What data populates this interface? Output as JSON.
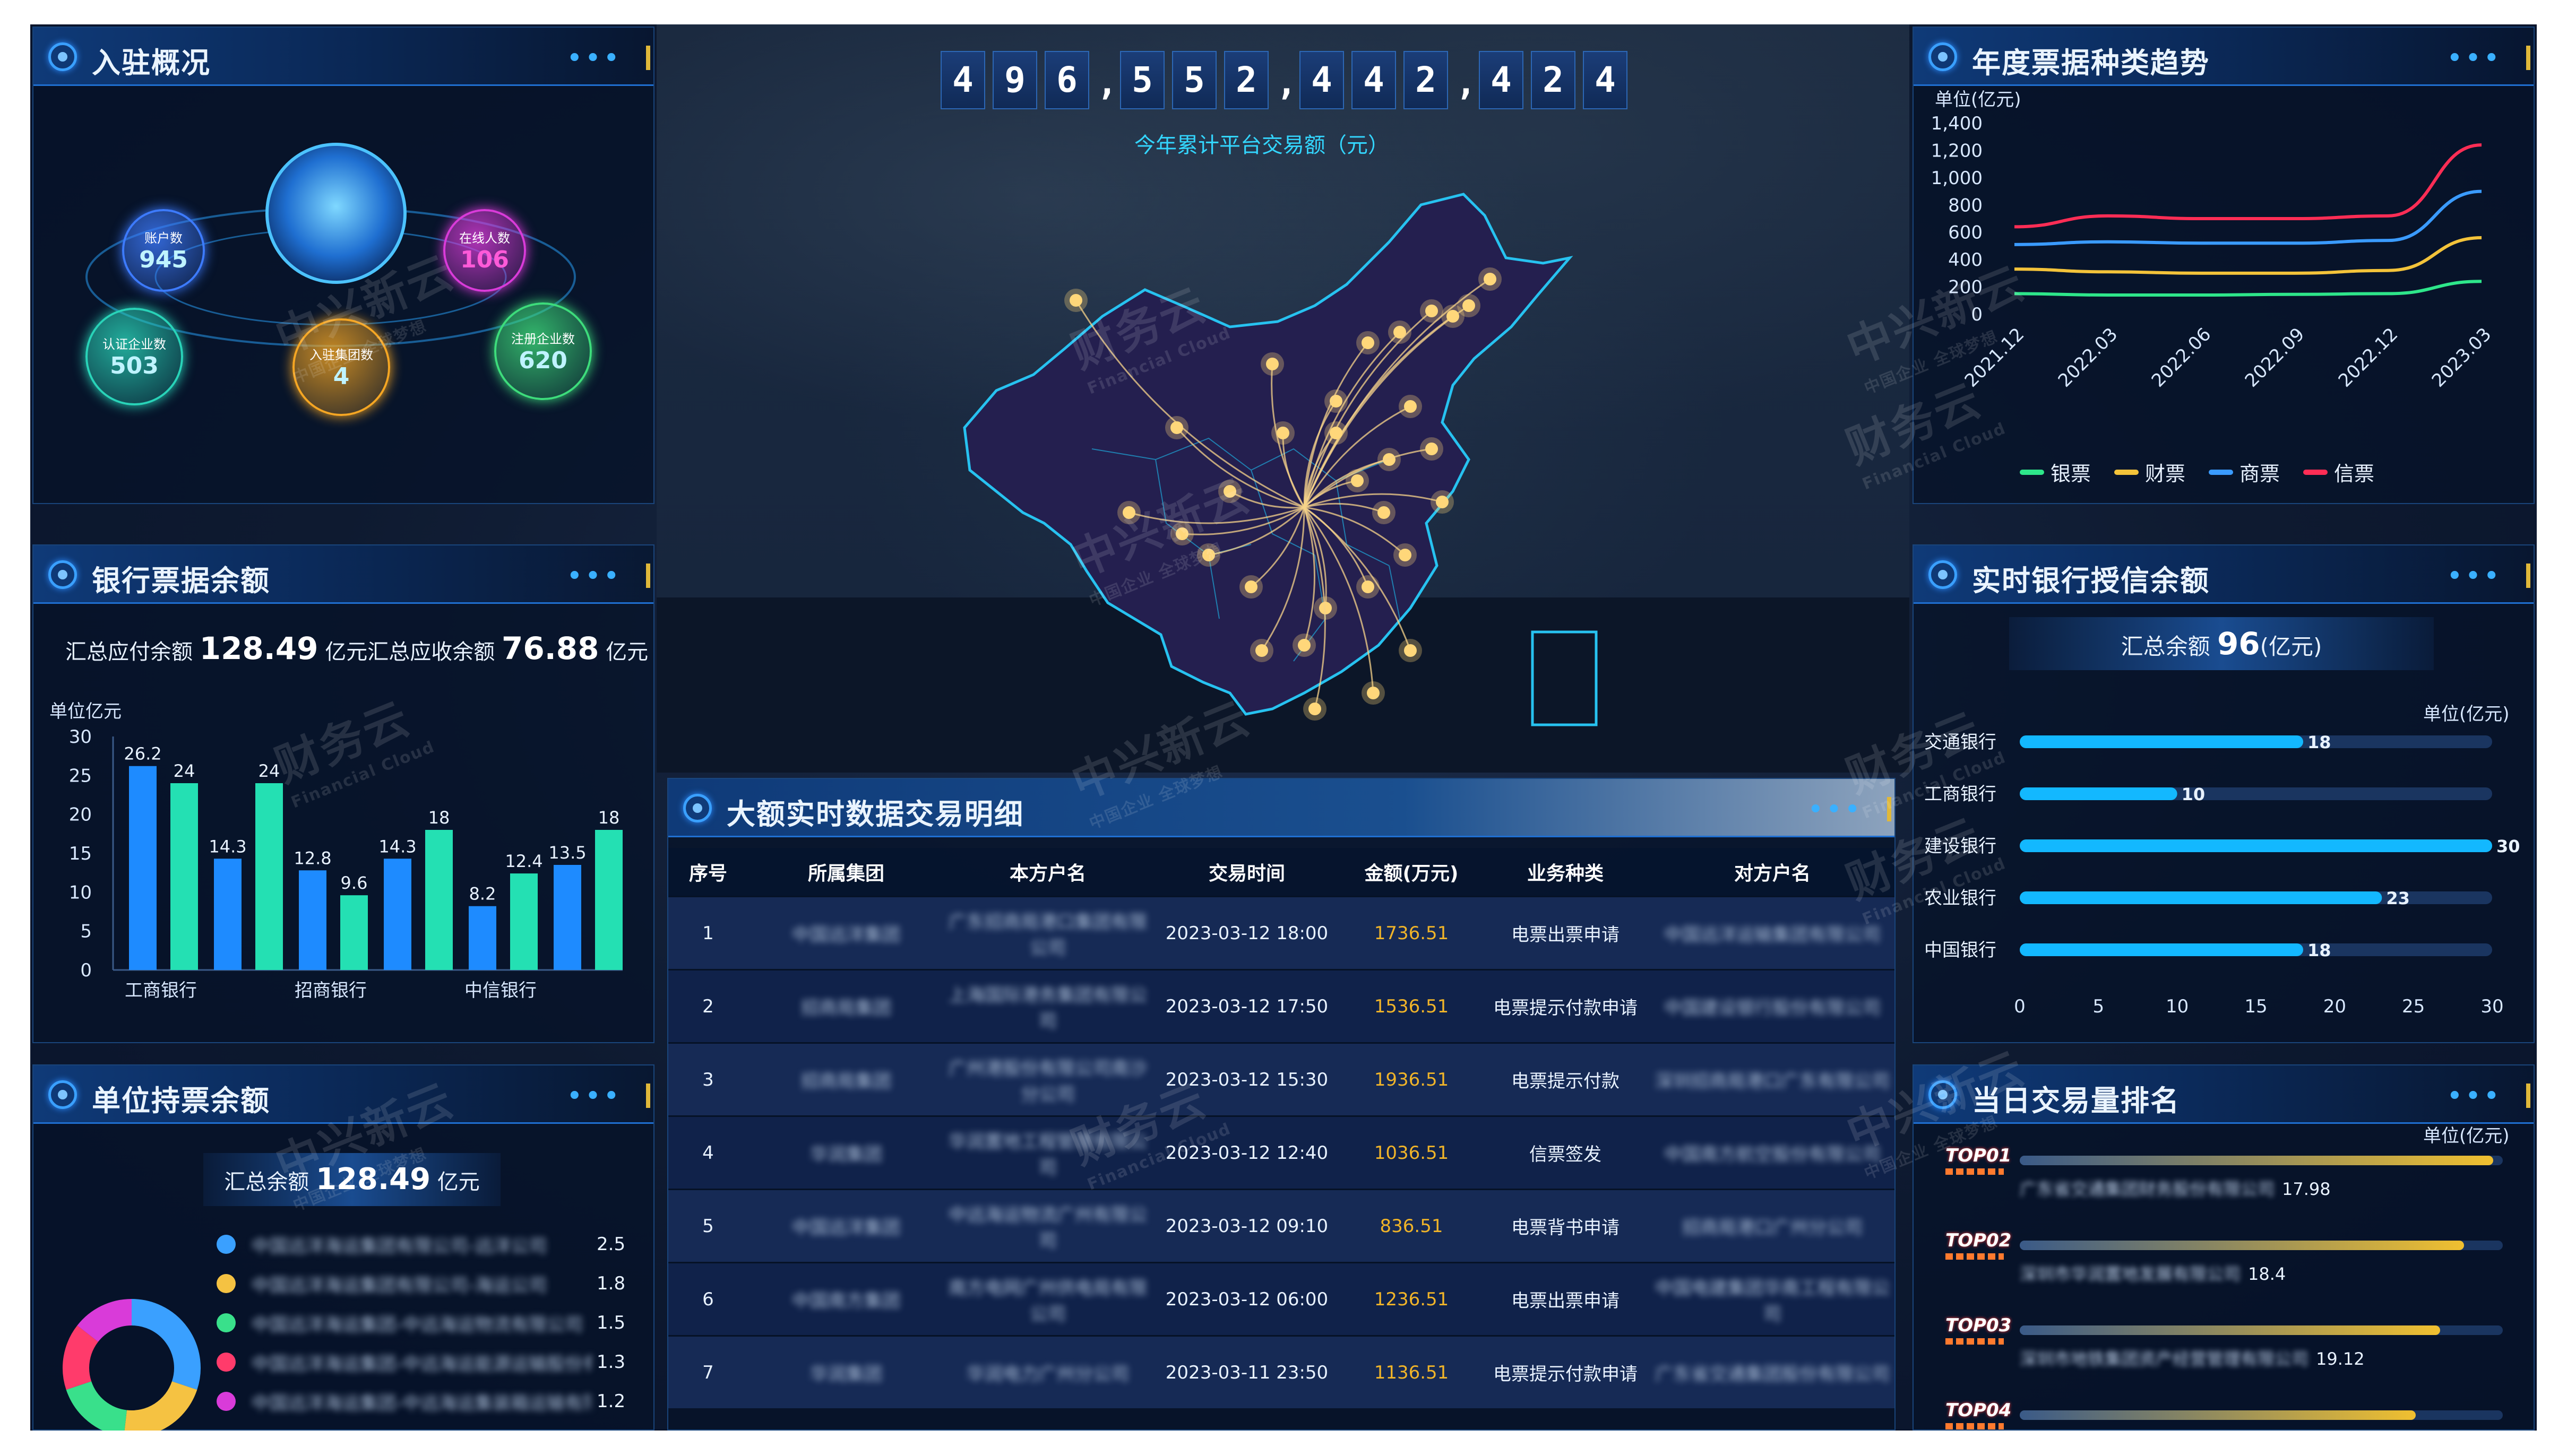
{
  "header": {
    "digits": [
      "4",
      "9",
      "6",
      ",",
      "5",
      "5",
      "2",
      ",",
      "4",
      "4",
      "2",
      ",",
      "4",
      "2",
      "4"
    ],
    "subtitle": "今年累计平台交易额（元）"
  },
  "watermark": {
    "main": "中兴新云",
    "sub": "财务云",
    "tag": "Financial Cloud",
    "slogan": "中国企业 全球梦想"
  },
  "panels": {
    "settled": {
      "title": "入驻概况",
      "more": "•••",
      "bubbles": [
        {
          "label": "账户数",
          "value": "945"
        },
        {
          "label": "在线人数",
          "value": "106"
        },
        {
          "label": "认证企业数",
          "value": "503"
        },
        {
          "label": "入驻集团数",
          "value": "4"
        },
        {
          "label": "注册企业数",
          "value": "620"
        }
      ]
    },
    "bank_bills": {
      "title": "银行票据余额",
      "more": "•••",
      "payable_label": "汇总应付余额",
      "payable_value": "128.49",
      "unit_yi": "亿元",
      "receivable_label": "汇总应收余额",
      "receivable_value": "76.88",
      "unit_label": "单位亿元"
    },
    "unit_holdings": {
      "title": "单位持票余额",
      "more": "•••",
      "summary_label": "汇总余额",
      "summary_value": "128.49",
      "summary_unit": "亿元",
      "items": [
        {
          "name": "中国远洋海运集团有限公司-远洋公司",
          "value": "2.5",
          "color": "#3aa0ff"
        },
        {
          "name": "中国远洋海运集团有限公司-海运公司",
          "value": "1.8",
          "color": "#f5c242"
        },
        {
          "name": "中国远洋海运集团-中远海运物流有限公司",
          "value": "1.5",
          "color": "#39e08b"
        },
        {
          "name": "中国远洋海运集团-中远海运能源运输股份有限公司",
          "value": "1.3",
          "color": "#ff3b6b"
        },
        {
          "name": "中国远洋海运集团-中远海运集装箱运输有限公司",
          "value": "1.2",
          "color": "#d93bd9"
        }
      ]
    },
    "annual_trend": {
      "title": "年度票据种类趋势",
      "more": "•••",
      "unit_label": "单位(亿元)"
    },
    "credit_balance": {
      "title": "实时银行授信余额",
      "more": "•••",
      "summary_prefix": "汇总余额",
      "summary_value": "96",
      "summary_unit": "(亿元)",
      "unit_label": "单位(亿元)",
      "banks": [
        {
          "name": "交通银行",
          "value": 18
        },
        {
          "name": "工商银行",
          "value": 10
        },
        {
          "name": "建设银行",
          "value": 30
        },
        {
          "name": "农业银行",
          "value": 23
        },
        {
          "name": "中国银行",
          "value": 18
        }
      ],
      "ticks": [
        "0",
        "5",
        "10",
        "15",
        "20",
        "25",
        "30"
      ]
    },
    "ranking": {
      "title": "当日交易量排名",
      "more": "•••",
      "unit_label": "单位(亿元)",
      "items": [
        {
          "rank": "TOP01",
          "name": "广东省交通集团财务股份有限公司",
          "value": "17.98",
          "fill": 0.98
        },
        {
          "rank": "TOP02",
          "name": "深圳市华润置地发展有限公司",
          "value": "18.4",
          "fill": 0.92
        },
        {
          "rank": "TOP03",
          "name": "深圳市地铁集团资产经营管理有限公司",
          "value": "19.12",
          "fill": 0.87
        },
        {
          "rank": "TOP04",
          "name": "",
          "value": "",
          "fill": 0.82
        }
      ]
    },
    "details": {
      "title": "大额实时数据交易明细",
      "more": "•••",
      "columns": [
        "序号",
        "所属集团",
        "本方户名",
        "交易时间",
        "金额(万元)",
        "业务种类",
        "对方户名"
      ],
      "rows": [
        {
          "no": "1",
          "group": "中国远洋集团",
          "own": "广东招商局港口集团有限公司",
          "time": "2023-03-12 18:00",
          "amount": "1736.51",
          "type": "电票出票申请",
          "counter": "中国远洋运输集团有限公司"
        },
        {
          "no": "2",
          "group": "招商局集团",
          "own": "上海国际港务集团有限公司",
          "time": "2023-03-12 17:50",
          "amount": "1536.51",
          "type": "电票提示付款申请",
          "counter": "中国建设银行股份有限公司"
        },
        {
          "no": "3",
          "group": "招商局集团",
          "own": "广州港股份有限公司南沙分公司",
          "time": "2023-03-12 15:30",
          "amount": "1936.51",
          "type": "电票提示付款",
          "counter": "深圳招商局港口广东有限公司"
        },
        {
          "no": "4",
          "group": "华润集团",
          "own": "华润置地工程管理有限公司",
          "time": "2023-03-12 12:40",
          "amount": "1036.51",
          "type": "信票签发",
          "counter": "中国南方航空股份有限公司"
        },
        {
          "no": "5",
          "group": "中国远洋集团",
          "own": "中远海运物流广州有限公司",
          "time": "2023-03-12 09:10",
          "amount": "836.51",
          "type": "电票背书申请",
          "counter": "招商局港口广州分公司"
        },
        {
          "no": "6",
          "group": "中国南方集团",
          "own": "南方电网广州供电局有限公司",
          "time": "2023-03-12 06:00",
          "amount": "1236.51",
          "type": "电票出票申请",
          "counter": "中国电建集团华南工程有限公司"
        },
        {
          "no": "7",
          "group": "华润集团",
          "own": "华润电力广州分公司",
          "time": "2023-03-11 23:50",
          "amount": "1136.51",
          "type": "电票提示付款申请",
          "counter": "广东省交通集团股份有限公司"
        }
      ]
    }
  },
  "chart_data": [
    {
      "type": "bar",
      "title": "银行票据余额",
      "categories": [
        "工商银行",
        "",
        "招商银行",
        "",
        "中信银行",
        ""
      ],
      "series": [
        {
          "values": [
            26.2,
            14.3,
            12.8,
            14.3,
            8.2,
            13.5
          ]
        },
        {
          "values": [
            24,
            24,
            9.6,
            18,
            12.4,
            18
          ]
        }
      ],
      "ylabel": "单位亿元",
      "ylim": [
        0,
        30
      ],
      "yticks": [
        "0",
        "5",
        "10",
        "15",
        "20",
        "25",
        "30"
      ],
      "colors": [
        "#1e8bff",
        "#24e0b3"
      ]
    },
    {
      "type": "line",
      "title": "年度票据种类趋势",
      "x": [
        "2021.12",
        "2022.03",
        "2022.06",
        "2022.09",
        "2022.12",
        "2023.03"
      ],
      "ylabel": "单位(亿元)",
      "ylim": [
        0,
        1400
      ],
      "yticks": [
        "0",
        "200",
        "400",
        "600",
        "800",
        "1,000",
        "1,200",
        "1,400"
      ],
      "series": [
        {
          "name": "银票",
          "color": "#2ee68a",
          "values": [
            150,
            140,
            140,
            145,
            150,
            240
          ]
        },
        {
          "name": "财票",
          "color": "#f3c33a",
          "values": [
            330,
            310,
            300,
            300,
            320,
            560
          ]
        },
        {
          "name": "商票",
          "color": "#3a9bff",
          "values": [
            510,
            530,
            520,
            520,
            540,
            900
          ]
        },
        {
          "name": "信票",
          "color": "#ff2d55",
          "values": [
            640,
            720,
            700,
            700,
            720,
            1240
          ]
        }
      ]
    },
    {
      "type": "bar",
      "title": "实时银行授信余额",
      "orientation": "horizontal",
      "categories": [
        "交通银行",
        "工商银行",
        "建设银行",
        "农业银行",
        "中国银行"
      ],
      "values": [
        18,
        10,
        30,
        23,
        18
      ],
      "xlim": [
        0,
        30
      ]
    },
    {
      "type": "pie",
      "title": "单位持票余额",
      "values": [
        2.5,
        1.8,
        1.5,
        1.3,
        1.2
      ],
      "colors": [
        "#3aa0ff",
        "#f5c242",
        "#39e08b",
        "#ff3b6b",
        "#d93bd9"
      ]
    }
  ]
}
